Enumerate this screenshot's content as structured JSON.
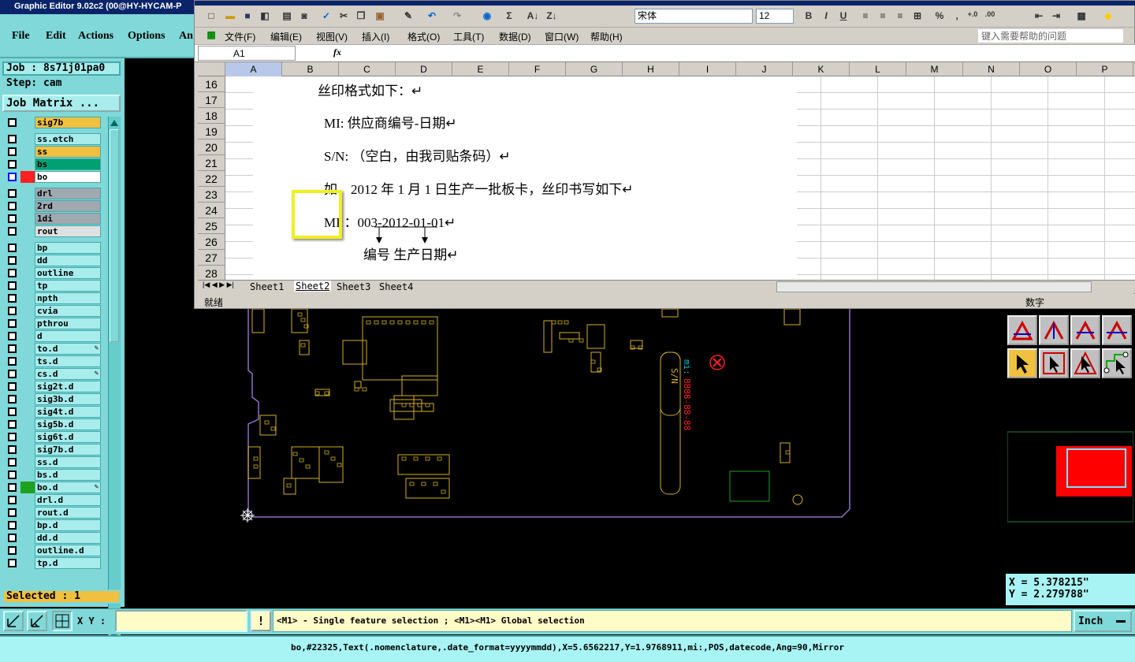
{
  "graphic_editor": {
    "title": "Graphic Editor 9.02c2 (00@HY-HYCAM-P",
    "menu": [
      "File",
      "Edit",
      "Actions",
      "Options",
      "An"
    ],
    "job_label": "Job : 8s71j01pa0",
    "step_label": "Step: cam",
    "job_matrix_button": "Job Matrix ...",
    "layers": [
      {
        "name": "sig7b",
        "color": "#f0c040"
      },
      {
        "name": "ss.etch",
        "color": "#a8ecec"
      },
      {
        "name": "ss",
        "color": "#f0c040"
      },
      {
        "name": "bs",
        "color": "#00a070"
      },
      {
        "name": "bo",
        "color": "#ffffff",
        "active": true
      },
      {
        "name": "drl",
        "color": "#a0a8b0"
      },
      {
        "name": "2rd",
        "color": "#a0a8b0"
      },
      {
        "name": "1di",
        "color": "#a0a8b0"
      },
      {
        "name": "rout",
        "color": "#e0e0e0"
      },
      {
        "name": "bp",
        "color": "#a8ecec"
      },
      {
        "name": "dd",
        "color": "#a8ecec"
      },
      {
        "name": "outline",
        "color": "#a8ecec"
      },
      {
        "name": "tp",
        "color": "#a8ecec"
      },
      {
        "name": "npth",
        "color": "#a8ecec"
      },
      {
        "name": "cvia",
        "color": "#a8ecec"
      },
      {
        "name": "pthrou",
        "color": "#a8ecec"
      },
      {
        "name": "d",
        "color": "#a8ecec"
      },
      {
        "name": "to.d",
        "color": "#a8ecec",
        "pen": true
      },
      {
        "name": "ts.d",
        "color": "#a8ecec"
      },
      {
        "name": "cs.d",
        "color": "#a8ecec",
        "pen": true
      },
      {
        "name": "sig2t.d",
        "color": "#a8ecec"
      },
      {
        "name": "sig3b.d",
        "color": "#a8ecec"
      },
      {
        "name": "sig4t.d",
        "color": "#a8ecec"
      },
      {
        "name": "sig5b.d",
        "color": "#a8ecec"
      },
      {
        "name": "sig6t.d",
        "color": "#a8ecec"
      },
      {
        "name": "sig7b.d",
        "color": "#a8ecec"
      },
      {
        "name": "ss.d",
        "color": "#a8ecec"
      },
      {
        "name": "bs.d",
        "color": "#a8ecec"
      },
      {
        "name": "bo.d",
        "color": "#a8ecec",
        "pen": true,
        "green": true
      },
      {
        "name": "drl.d",
        "color": "#a8ecec"
      },
      {
        "name": "rout.d",
        "color": "#a8ecec"
      },
      {
        "name": "bp.d",
        "color": "#a8ecec"
      },
      {
        "name": "dd.d",
        "color": "#a8ecec"
      },
      {
        "name": "outline.d",
        "color": "#a8ecec"
      },
      {
        "name": "tp.d",
        "color": "#a8ecec"
      }
    ],
    "selected_label": "Selected : 1",
    "xy_label": "X Y :",
    "xy_value": "",
    "hint_text": "<M1> - Single feature selection ; <M1><M1> Global selection",
    "units_button": "Inch",
    "coord_x": "X = 5.378215\"",
    "coord_y": "Y = 2.279788\"",
    "status_line": "bo,#22325,Text(.nomenclature,.date_format=yyyymmdd),X=5.6562217,Y=1.9768911,mi:,POS,datecode,Ang=90,Mirror",
    "pcb_marks": {
      "sn": "S/N",
      "mi": "mi:",
      "date": "8888-88-88"
    }
  },
  "excel": {
    "menu": [
      "文件(F)",
      "编辑(E)",
      "视图(V)",
      "插入(I)",
      "格式(O)",
      "工具(T)",
      "数据(D)",
      "窗口(W)",
      "帮助(H)"
    ],
    "help_search_placeholder": "键入需要帮助的问题",
    "font_name": "宋体",
    "font_size": "12",
    "name_box": "A1",
    "fx": "fx",
    "columns": [
      "A",
      "B",
      "C",
      "D",
      "E",
      "F",
      "G",
      "H",
      "I",
      "J",
      "K",
      "L",
      "M",
      "N",
      "O",
      "P"
    ],
    "rows": [
      "16",
      "17",
      "18",
      "19",
      "20",
      "21",
      "22",
      "23",
      "24",
      "25",
      "26",
      "27",
      "28"
    ],
    "doc_lines": [
      "丝印格式如下：↵",
      "MI: 供应商编号-日期↵",
      "S/N: （空白，由我司贴条码）↵",
      "如，2012 年 1 月 1 日生产一批板卡，丝印书写如下↵",
      "MI:：003-2012-01-01↵",
      "编号  生产日期↵"
    ],
    "sheet_tabs": [
      "Sheet1",
      "Sheet2",
      "Sheet3",
      "Sheet4"
    ],
    "active_sheet": "Sheet2",
    "status_ready": "就绪",
    "status_num": "数字"
  }
}
